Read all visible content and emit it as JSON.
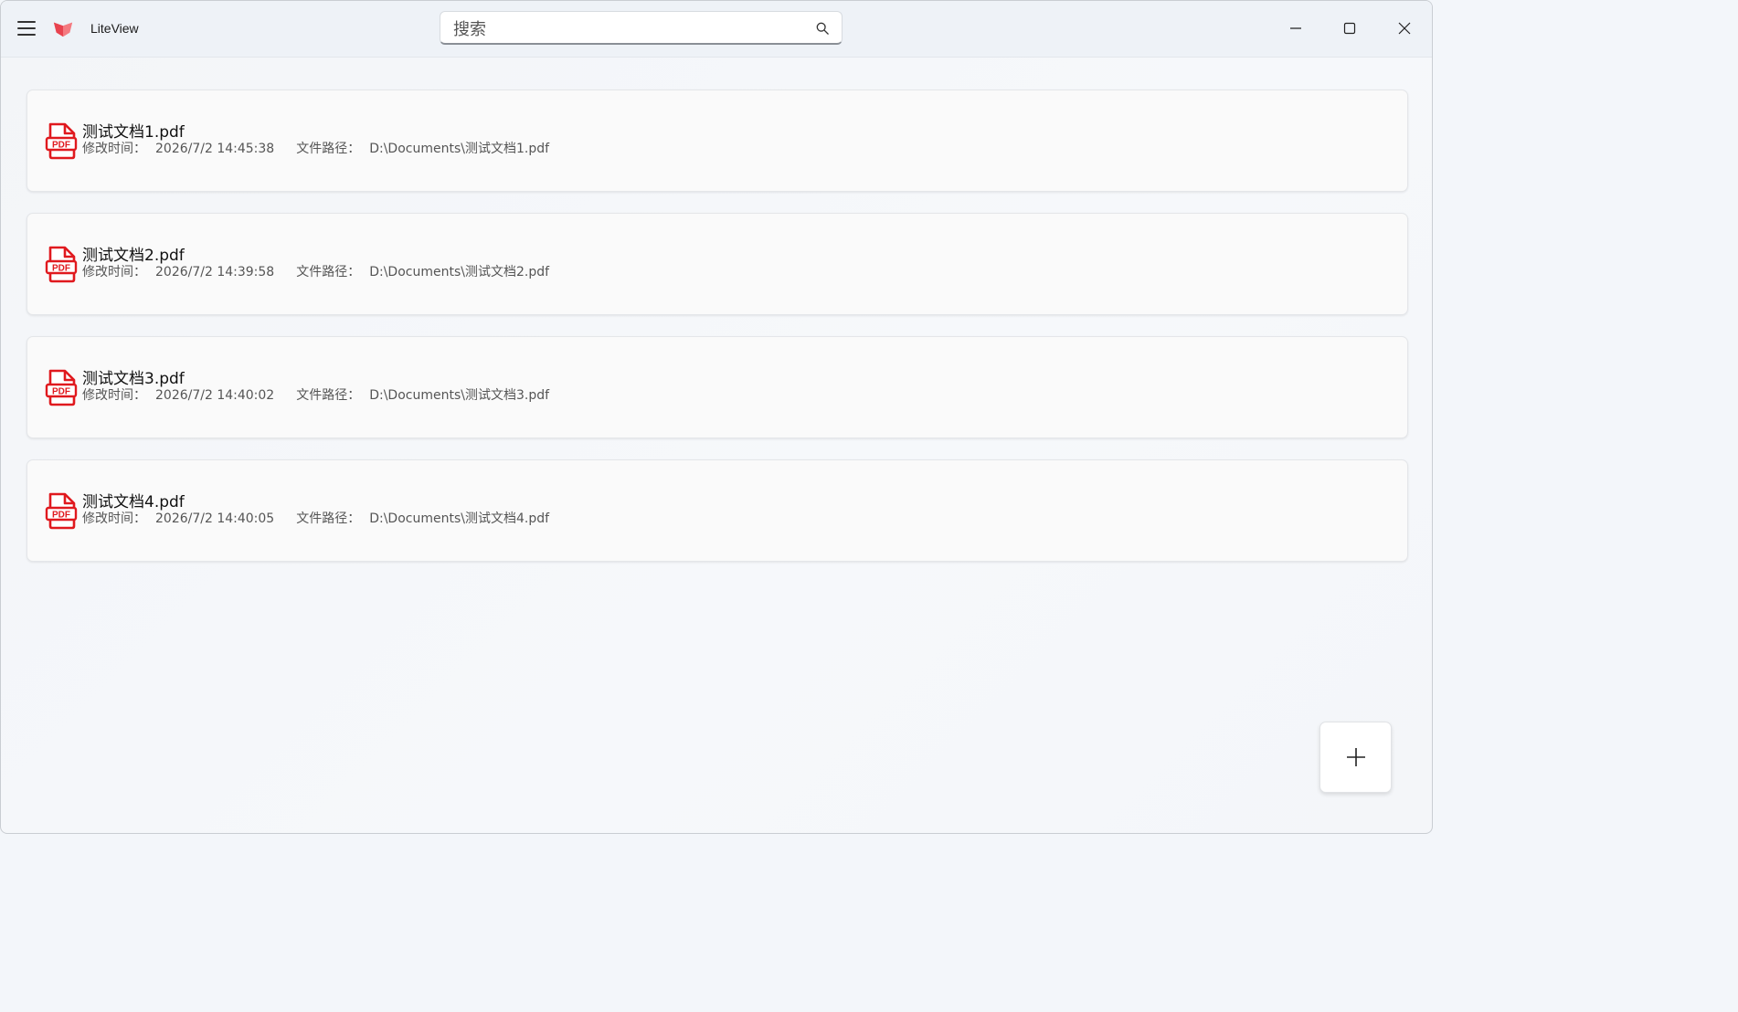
{
  "app": {
    "title": "LiteView",
    "menu_icon": "hamburger-menu-icon",
    "logo_icon": "liteview-logo-icon",
    "accent_color": "#e8434f"
  },
  "search": {
    "placeholder": "搜索",
    "value": "",
    "icon": "search-icon"
  },
  "window_controls": {
    "minimize_icon": "minimize-icon",
    "maximize_icon": "maximize-icon",
    "close_icon": "close-icon"
  },
  "files": [
    {
      "name": "测试文档1.pdf",
      "modified_label": "修改时间：",
      "modified": "2026/7/2 14:45:38",
      "path_label": "文件路径：",
      "path": "D:\\Documents\\测试文档1.pdf"
    },
    {
      "name": "测试文档2.pdf",
      "modified_label": "修改时间：",
      "modified": "2026/7/2 14:39:58",
      "path_label": "文件路径：",
      "path": "D:\\Documents\\测试文档2.pdf"
    },
    {
      "name": "测试文档3.pdf",
      "modified_label": "修改时间：",
      "modified": "2026/7/2 14:40:02",
      "path_label": "文件路径：",
      "path": "D:\\Documents\\测试文档3.pdf"
    },
    {
      "name": "测试文档4.pdf",
      "modified_label": "修改时间：",
      "modified": "2026/7/2 14:40:05",
      "path_label": "文件路径：",
      "path": "D:\\Documents\\测试文档4.pdf"
    }
  ],
  "file_icon": {
    "name": "pdf-file-icon",
    "label": "PDF",
    "color": "#e0191e"
  },
  "fab": {
    "icon": "plus-icon"
  }
}
